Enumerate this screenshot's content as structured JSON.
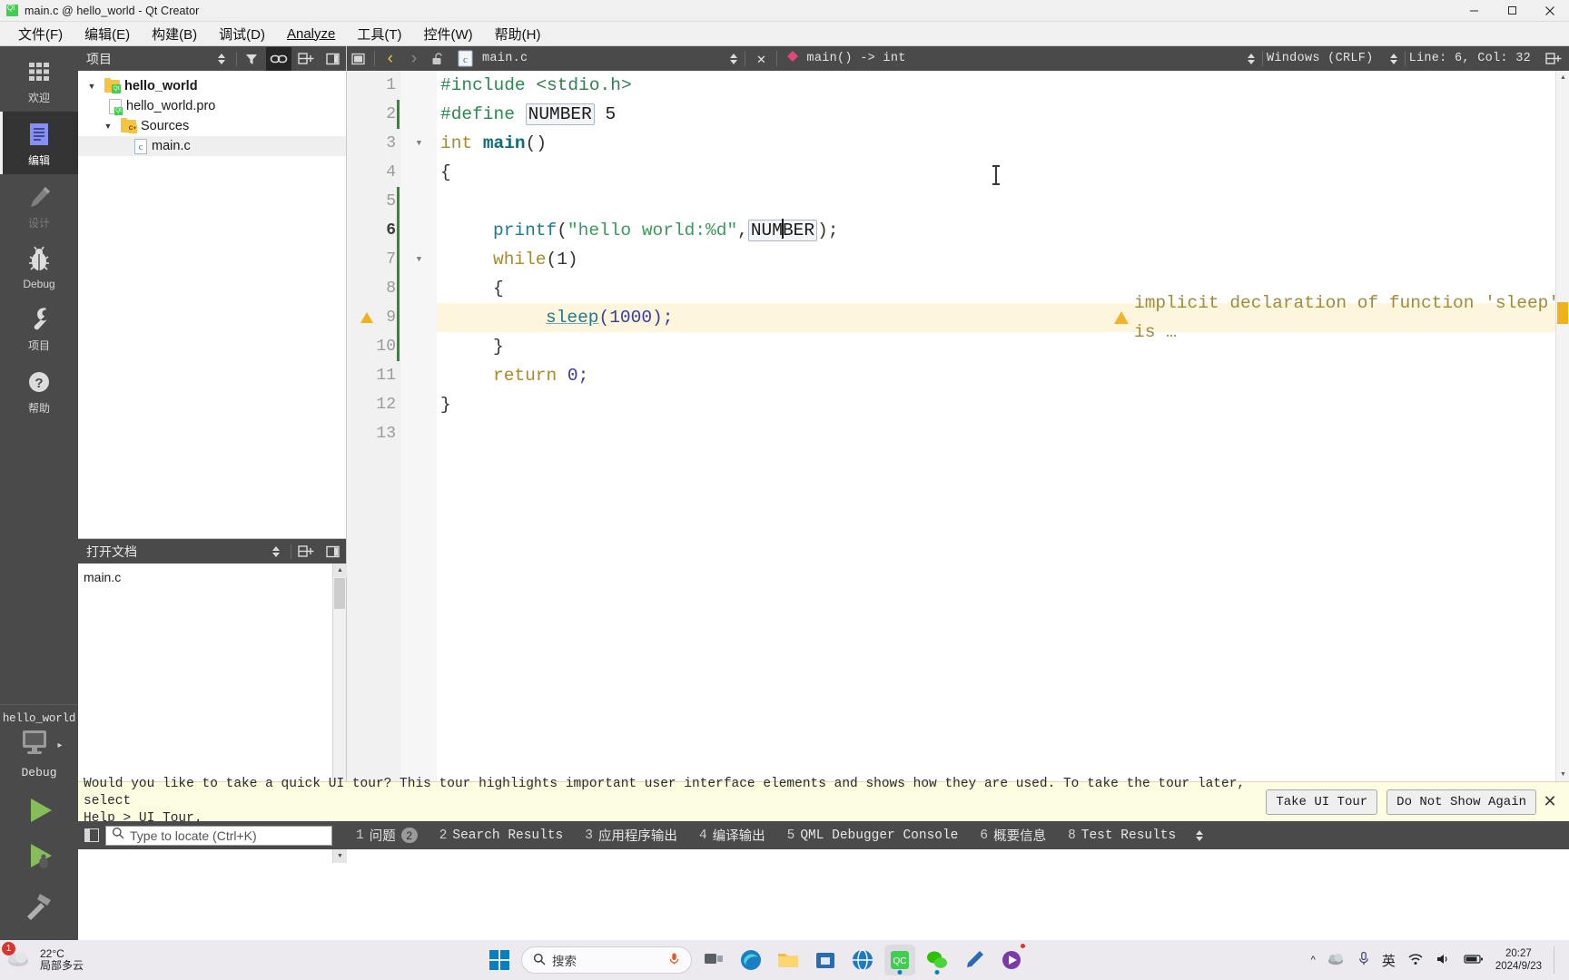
{
  "window": {
    "title": "main.c @ hello_world - Qt Creator",
    "app_icon": "qt-logo-icon",
    "minimize": "—",
    "maximize": "❐",
    "close": "✕"
  },
  "menubar": [
    {
      "label": "文件(F)",
      "mnemonic": "F"
    },
    {
      "label": "编辑(E)",
      "mnemonic": "E"
    },
    {
      "label": "构建(B)",
      "mnemonic": "B"
    },
    {
      "label": "调试(D)",
      "mnemonic": "D"
    },
    {
      "label": "Analyze",
      "mnemonic": "A"
    },
    {
      "label": "工具(T)",
      "mnemonic": "T"
    },
    {
      "label": "控件(W)",
      "mnemonic": "W"
    },
    {
      "label": "帮助(H)",
      "mnemonic": "H"
    }
  ],
  "modebar": {
    "modes": [
      {
        "label": "欢迎",
        "icon": "grid-icon",
        "state": "normal"
      },
      {
        "label": "编辑",
        "icon": "document-lines-icon",
        "state": "active"
      },
      {
        "label": "设计",
        "icon": "pencil-icon",
        "state": "disabled"
      },
      {
        "label": "Debug",
        "icon": "bug-icon",
        "state": "normal"
      },
      {
        "label": "项目",
        "icon": "wrench-icon",
        "state": "normal"
      },
      {
        "label": "帮助",
        "icon": "question-circle-icon",
        "state": "normal"
      }
    ],
    "kit": {
      "project_name": "hello_world",
      "icon": "desktop-monitor-icon",
      "build_config": "Debug",
      "arrow": "▸"
    },
    "run_buttons": [
      {
        "name": "run-button",
        "icon": "play-triangle-icon",
        "color": "#87bc5a"
      },
      {
        "name": "debug-button",
        "icon": "play-bug-icon",
        "color": "#87bc5a"
      },
      {
        "name": "build-button",
        "icon": "hammer-icon",
        "color": "#b0b0b0"
      }
    ]
  },
  "project_pane": {
    "title": "项目",
    "toolbar": [
      {
        "name": "filter-button",
        "icon": "funnel-icon"
      },
      {
        "name": "link-with-editor-button",
        "icon": "chain-link-icon",
        "active": true
      },
      {
        "name": "split-button",
        "icon": "split-plus-icon"
      },
      {
        "name": "close-pane-button",
        "icon": "close-pane-icon"
      }
    ],
    "tree": [
      {
        "label": "hello_world",
        "icon": "qt-project-folder-icon",
        "indent": 0,
        "expanded": true,
        "bold": true,
        "selected": false
      },
      {
        "label": "hello_world.pro",
        "icon": "qt-pro-file-icon",
        "indent": 1,
        "expanded": null,
        "bold": false,
        "selected": false
      },
      {
        "label": "Sources",
        "icon": "cpp-folder-icon",
        "indent": 1,
        "expanded": true,
        "bold": false,
        "selected": false
      },
      {
        "label": "main.c",
        "icon": "c-file-icon",
        "indent": 2,
        "expanded": null,
        "bold": false,
        "selected": true
      }
    ]
  },
  "documents_pane": {
    "title": "打开文档",
    "toolbar": [
      {
        "name": "split-button",
        "icon": "split-plus-icon"
      },
      {
        "name": "close-pane-button",
        "icon": "close-pane-icon"
      }
    ],
    "items": [
      {
        "label": "main.c"
      }
    ]
  },
  "editor_toolbar": {
    "back_icon": "chevron-left-icon",
    "forward_icon": "chevron-right-icon",
    "lock_icon": "unlocked-padlock-icon",
    "file_icon": "c-file-icon",
    "filename": "main.c",
    "close_icon": "close-x-icon",
    "symbol_icon": "function-diamond-icon",
    "symbol": "main() -> int",
    "line_ending": "Windows (CRLF)",
    "cursor_position": "Line: 6, Col: 32",
    "split_icon": "split-plus-icon"
  },
  "code": {
    "lines": [
      {
        "num": "1",
        "fold": null,
        "current": false,
        "modified": false,
        "warning": false
      },
      {
        "num": "2",
        "fold": null,
        "current": false,
        "modified": true,
        "warning": false
      },
      {
        "num": "3",
        "fold": "open",
        "current": false,
        "modified": false,
        "warning": false
      },
      {
        "num": "4",
        "fold": null,
        "current": false,
        "modified": false,
        "warning": false
      },
      {
        "num": "5",
        "fold": null,
        "current": false,
        "modified": true,
        "warning": false
      },
      {
        "num": "6",
        "fold": null,
        "current": true,
        "modified": true,
        "warning": false
      },
      {
        "num": "7",
        "fold": "open",
        "current": false,
        "modified": true,
        "warning": false
      },
      {
        "num": "8",
        "fold": null,
        "current": false,
        "modified": true,
        "warning": false
      },
      {
        "num": "9",
        "fold": null,
        "current": false,
        "modified": true,
        "warning": true
      },
      {
        "num": "10",
        "fold": null,
        "current": false,
        "modified": true,
        "warning": false
      },
      {
        "num": "11",
        "fold": null,
        "current": false,
        "modified": false,
        "warning": false
      },
      {
        "num": "12",
        "fold": null,
        "current": false,
        "modified": false,
        "warning": false
      },
      {
        "num": "13",
        "fold": null,
        "current": false,
        "modified": false,
        "warning": false
      }
    ],
    "text": {
      "l1_include": "#include",
      "l1_header": "<stdio.h>",
      "l2_define": "#define",
      "l2_macro": "NUMBER",
      "l2_value": "5",
      "l3_type": "int",
      "l3_name": "main",
      "l3_parens": "()",
      "l4": "{",
      "l6_call": "printf",
      "l6_string": "\"hello world:%d\"",
      "l6_macro_a": "NUM",
      "l6_macro_b": "BER",
      "l6_tail": ");",
      "l7_kw": "while",
      "l7_cond": "(1)",
      "l8": "{",
      "l9_call": "sleep",
      "l9_arg": "(1000);",
      "l9_warning": "implicit declaration of function 'sleep' is …",
      "l10": "}",
      "l11_kw": "return",
      "l11_val": "0;",
      "l12": "}"
    }
  },
  "tour_banner": {
    "line1": "Would you like to take a quick UI tour? This tour highlights important user interface elements and shows how they are used. To take the tour later, select",
    "line2": "Help > UI Tour.",
    "take_button": "Take UI Tour",
    "dismiss_button": "Do Not Show Again",
    "close_icon": "close-x-icon"
  },
  "output_bar": {
    "sidebar_toggle_icon": "toggle-sidebar-icon",
    "locator": {
      "icon": "search-icon",
      "placeholder": "Type to locate (Ctrl+K)",
      "value": ""
    },
    "tabs": [
      {
        "num": "1",
        "label": "问题",
        "badge": "2"
      },
      {
        "num": "2",
        "label": "Search Results",
        "badge": null
      },
      {
        "num": "3",
        "label": "应用程序输出",
        "badge": null
      },
      {
        "num": "4",
        "label": "编译输出",
        "badge": null
      },
      {
        "num": "5",
        "label": "QML Debugger Console",
        "badge": null
      },
      {
        "num": "6",
        "label": "概要信息",
        "badge": null
      },
      {
        "num": "8",
        "label": "Test Results",
        "badge": null
      }
    ],
    "overflow_icon": "updown-chevron-icon"
  },
  "taskbar": {
    "weather": {
      "icon": "cloud-icon",
      "temp": "22°C",
      "desc": "局部多云"
    },
    "notification_count": "1",
    "windows_icon": "windows-logo-icon",
    "search": {
      "icon": "search-icon",
      "label": "搜索",
      "mic_icon": "microphone-icon"
    },
    "apps": [
      {
        "name": "task-view-icon",
        "glyph": "▭",
        "color": "#4a4a4a",
        "running": false
      },
      {
        "name": "edge-browser-icon",
        "glyph": "◌",
        "color": "#0f7ac0",
        "running": false
      },
      {
        "name": "file-explorer-icon",
        "glyph": "▰",
        "color": "#f5b942",
        "running": false
      },
      {
        "name": "store-icon",
        "glyph": "▣",
        "color": "#2b6cb0",
        "running": false
      },
      {
        "name": "browser-icon",
        "glyph": "◐",
        "color": "#1f7ac0",
        "running": false
      },
      {
        "name": "qt-creator-icon",
        "glyph": "QC",
        "color": "#41cd52",
        "running": true
      },
      {
        "name": "wechat-icon",
        "glyph": "◉",
        "color": "#2dc100",
        "running": true
      },
      {
        "name": "editor-icon",
        "glyph": "✎",
        "color": "#2b6cb0",
        "running": false
      },
      {
        "name": "media-icon",
        "glyph": "▶",
        "color": "#7a3ba8",
        "running": true
      }
    ],
    "tray": [
      {
        "name": "show-hidden-icons",
        "glyph": "ⱏ"
      },
      {
        "name": "onedrive-icon",
        "glyph": "☁"
      },
      {
        "name": "microphone-icon",
        "glyph": "ᵜ"
      },
      {
        "name": "ime-indicator",
        "glyph": "英"
      },
      {
        "name": "wifi-icon",
        "glyph": "◠"
      },
      {
        "name": "volume-icon",
        "glyph": "◁"
      },
      {
        "name": "battery-icon",
        "glyph": "▬"
      }
    ],
    "clock": {
      "time": "20:27",
      "date": "2024/9/23"
    }
  }
}
